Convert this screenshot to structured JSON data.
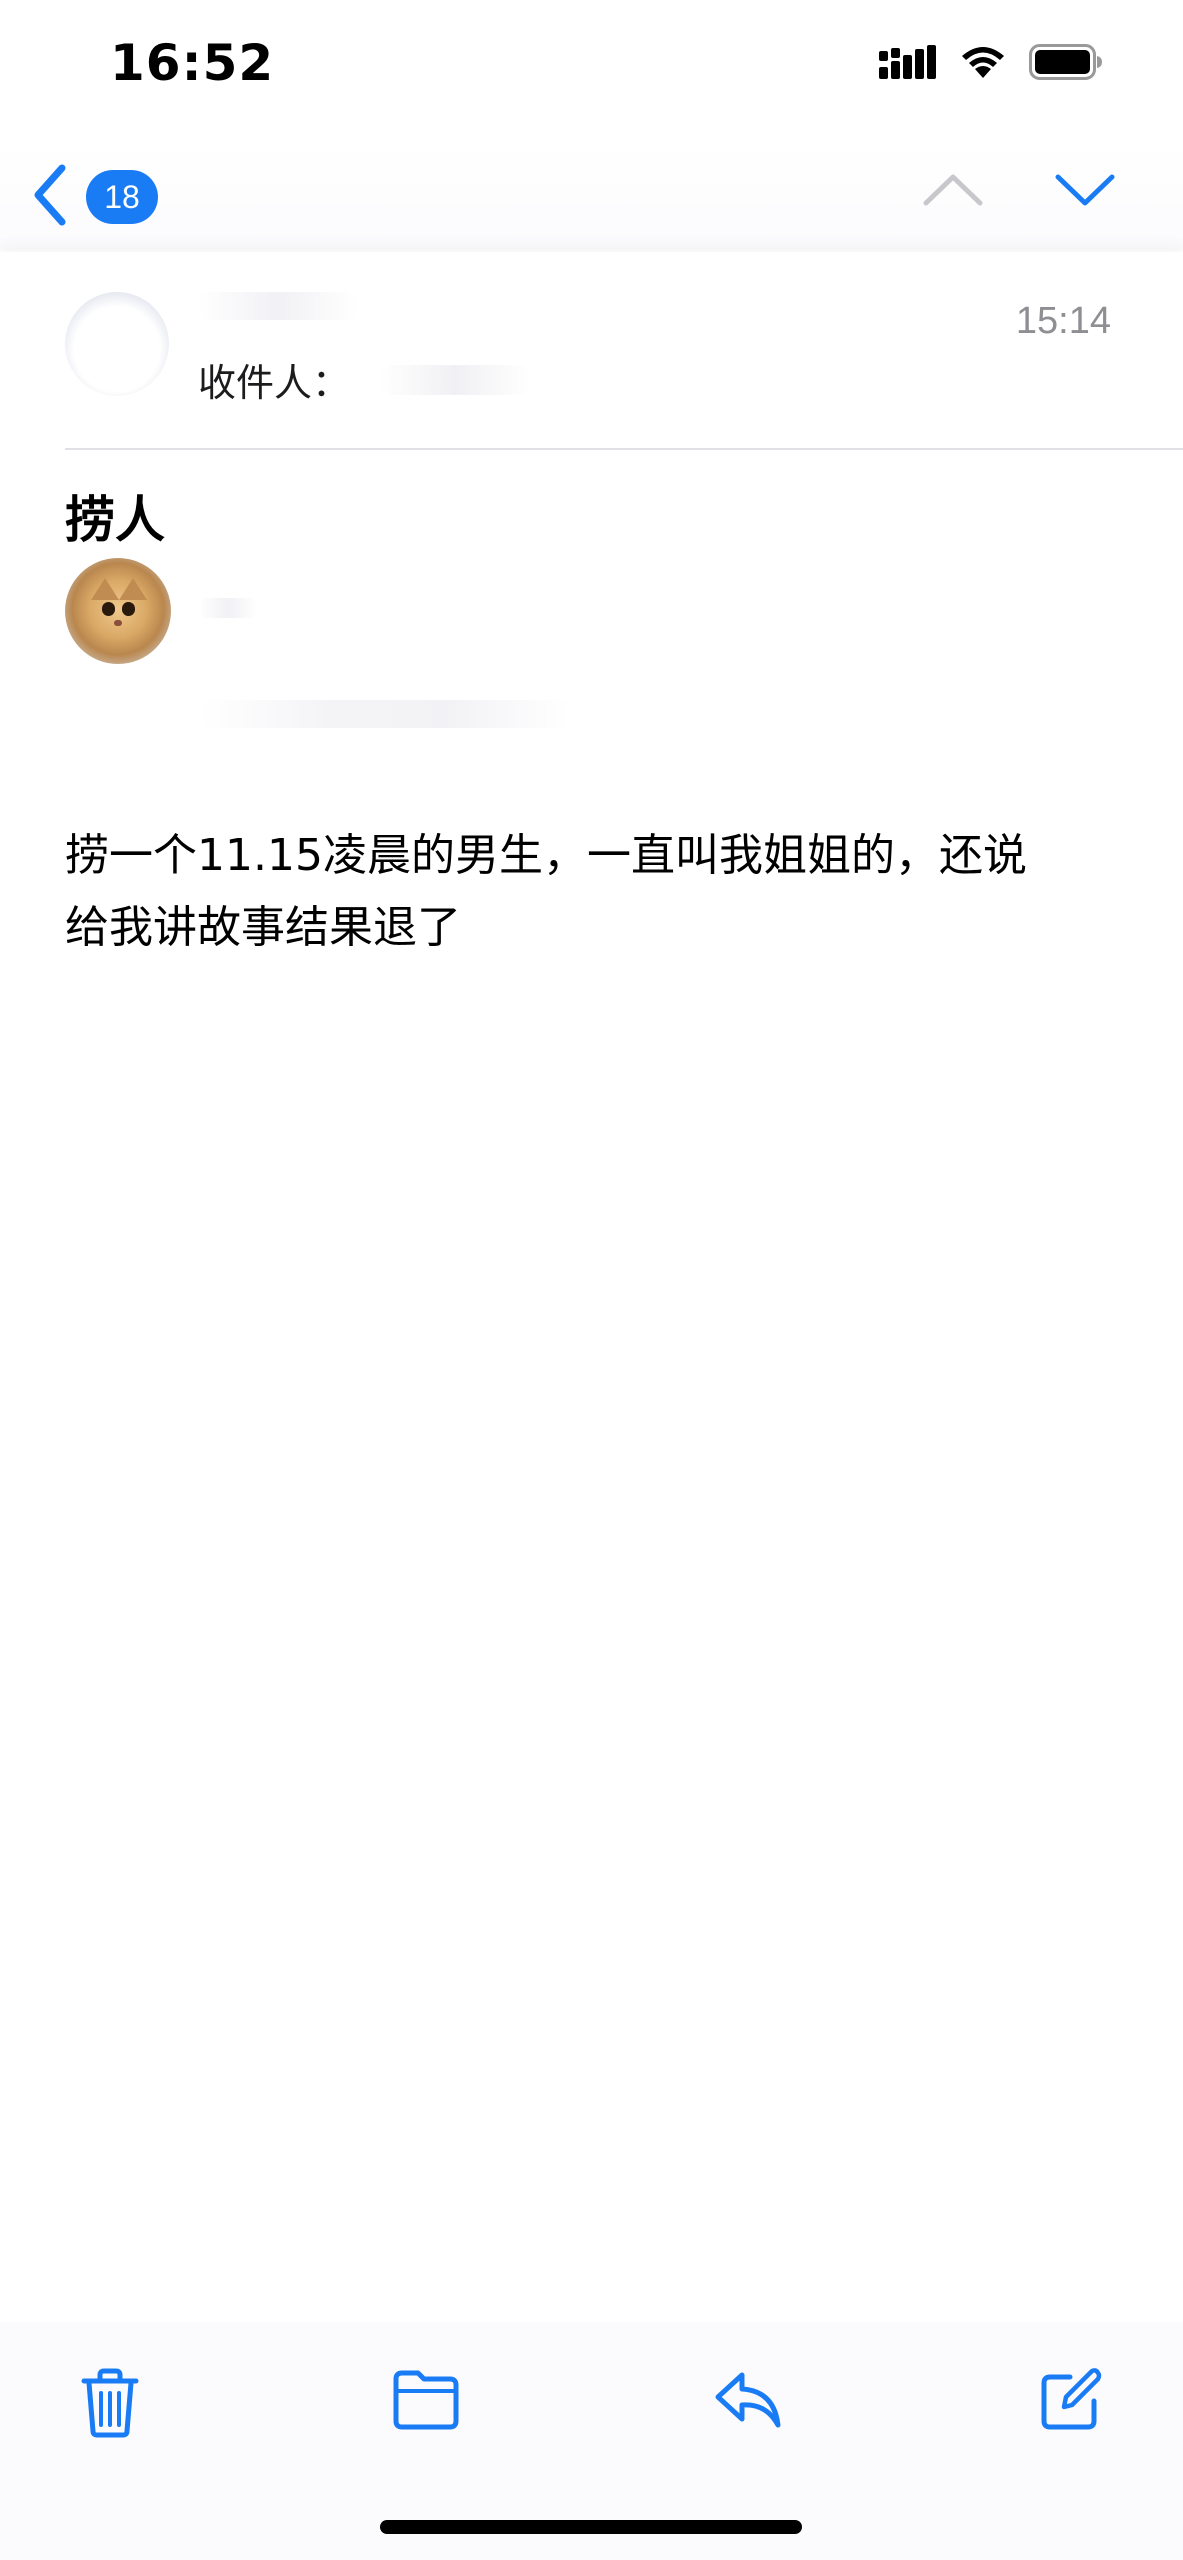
{
  "status_bar": {
    "time": "16:52",
    "icons": [
      "cellular-signal-icon",
      "wifi-icon",
      "battery-icon"
    ]
  },
  "nav": {
    "back_icon": "chevron-left-icon",
    "unread_count": "18",
    "prev_icon": "chevron-up-icon",
    "next_icon": "chevron-down-icon"
  },
  "mail": {
    "recipient_label": "收件人：",
    "time": "15:14",
    "subject": "捞人",
    "body_lines": [
      "捞一个11.15凌晨的男生，一直叫我姐姐的，还说",
      "给我讲故事结果退了"
    ]
  },
  "toolbar": {
    "items": [
      "trash-icon",
      "folder-icon",
      "reply-icon",
      "compose-icon"
    ]
  },
  "colors": {
    "accent": "#1a7cf5",
    "disabled": "#c7c7cc",
    "secondary_text": "#8e8e93"
  }
}
